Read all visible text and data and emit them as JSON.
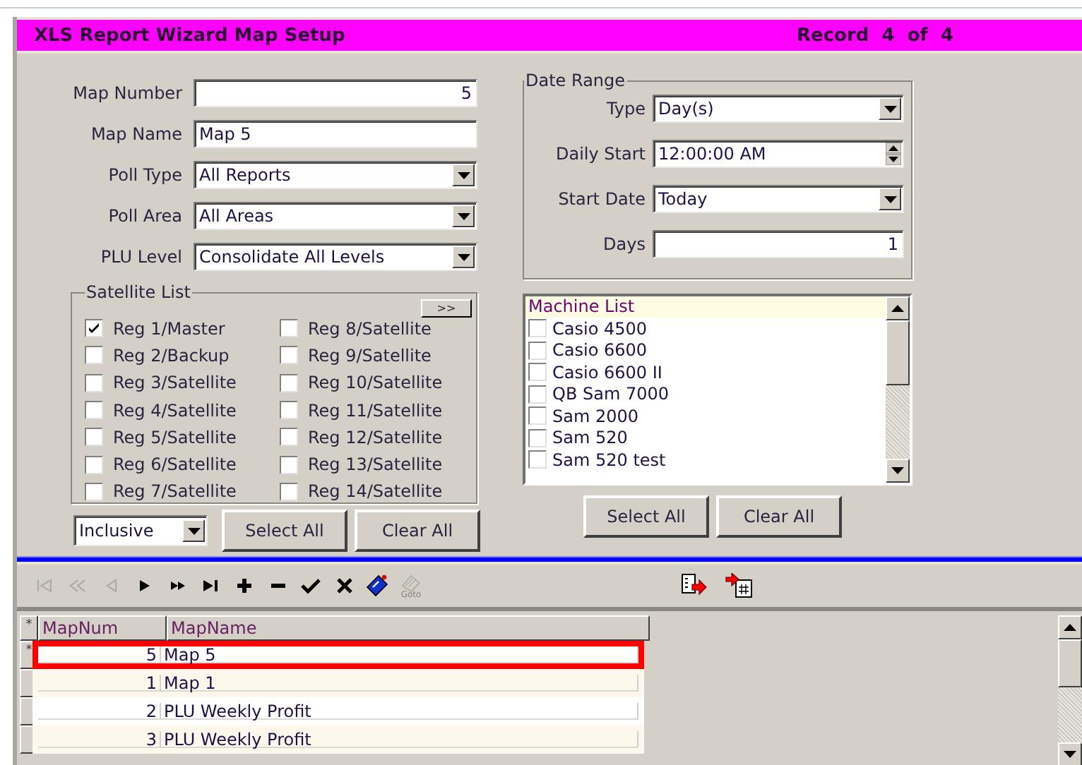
{
  "title": "XLS Report Wizard Map Setup",
  "record": "Record  4  of  4",
  "fields": [
    {
      "label": "Map Number",
      "value": "5",
      "kind": "number"
    },
    {
      "label": "Map Name",
      "value": "Map 5",
      "kind": "text"
    },
    {
      "label": "Poll Type",
      "value": "All Reports",
      "kind": "select"
    },
    {
      "label": "Poll Area",
      "value": "All Areas",
      "kind": "select"
    },
    {
      "label": "PLU Level",
      "value": "Consolidate All Levels",
      "kind": "select"
    }
  ],
  "satellite_list": {
    "legend": "Satellite List",
    "toggle": ">>",
    "items": [
      {
        "label": "Reg 1/Master",
        "checked": true
      },
      {
        "label": "Reg 2/Backup",
        "checked": false
      },
      {
        "label": "Reg 3/Satellite",
        "checked": false
      },
      {
        "label": "Reg 4/Satellite",
        "checked": false
      },
      {
        "label": "Reg 5/Satellite",
        "checked": false
      },
      {
        "label": "Reg 6/Satellite",
        "checked": false
      },
      {
        "label": "Reg 7/Satellite",
        "checked": false
      },
      {
        "label": "Reg 8/Satellite",
        "checked": false
      },
      {
        "label": "Reg 9/Satellite",
        "checked": false
      },
      {
        "label": "Reg 10/Satellite",
        "checked": false
      },
      {
        "label": "Reg 11/Satellite",
        "checked": false
      },
      {
        "label": "Reg 12/Satellite",
        "checked": false
      },
      {
        "label": "Reg 13/Satellite",
        "checked": false
      },
      {
        "label": "Reg 14/Satellite",
        "checked": false
      }
    ]
  },
  "mode_select": "Inclusive",
  "left_buttons": [
    "Select All",
    "Clear All"
  ],
  "date_range": {
    "legend": "Date Range",
    "fields": [
      {
        "label": "Type",
        "value": "Day(s)",
        "kind": "select"
      },
      {
        "label": "Daily Start",
        "value": "12:00:00 AM",
        "kind": "spin"
      },
      {
        "label": "Start Date",
        "value": "Today",
        "kind": "select"
      },
      {
        "label": "Days",
        "value": "1",
        "kind": "number"
      }
    ]
  },
  "machine_list": {
    "header": "Machine List",
    "items": [
      {
        "label": "Casio 4500",
        "checked": false
      },
      {
        "label": "Casio 6600",
        "checked": false
      },
      {
        "label": "Casio 6600 II",
        "checked": false
      },
      {
        "label": "QB Sam 7000",
        "checked": false
      },
      {
        "label": "Sam 2000",
        "checked": false
      },
      {
        "label": "Sam 520",
        "checked": false
      },
      {
        "label": "Sam 520 test",
        "checked": false
      }
    ]
  },
  "right_buttons": [
    "Select All",
    "Clear All"
  ],
  "toolbar": [
    {
      "kind": "first",
      "disabled": true
    },
    {
      "kind": "prev_page",
      "disabled": true
    },
    {
      "kind": "prev",
      "disabled": true
    },
    {
      "kind": "next",
      "disabled": false
    },
    {
      "kind": "next_page",
      "disabled": false
    },
    {
      "kind": "last",
      "disabled": false
    },
    {
      "kind": "add",
      "disabled": false
    },
    {
      "kind": "remove",
      "disabled": false
    },
    {
      "kind": "post",
      "disabled": false
    },
    {
      "kind": "cancel",
      "disabled": false
    },
    {
      "kind": "tag",
      "disabled": false
    },
    {
      "kind": "goto",
      "disabled": true,
      "caption": "Goto"
    }
  ],
  "export_tools": [
    {
      "kind": "export"
    },
    {
      "kind": "import"
    }
  ],
  "grid": {
    "header_marker": "*",
    "columns": [
      "MapNum",
      "MapName"
    ],
    "rows": [
      {
        "marker": "*",
        "map_num": "5",
        "map_name": "Map 5",
        "selected": true
      },
      {
        "map_num": "1",
        "map_name": "Map 1",
        "selected": false
      },
      {
        "map_num": "2",
        "map_name": "PLU Weekly Profit",
        "selected": false
      },
      {
        "map_num": "3",
        "map_name": "PLU Weekly Profit",
        "selected": false
      }
    ]
  }
}
